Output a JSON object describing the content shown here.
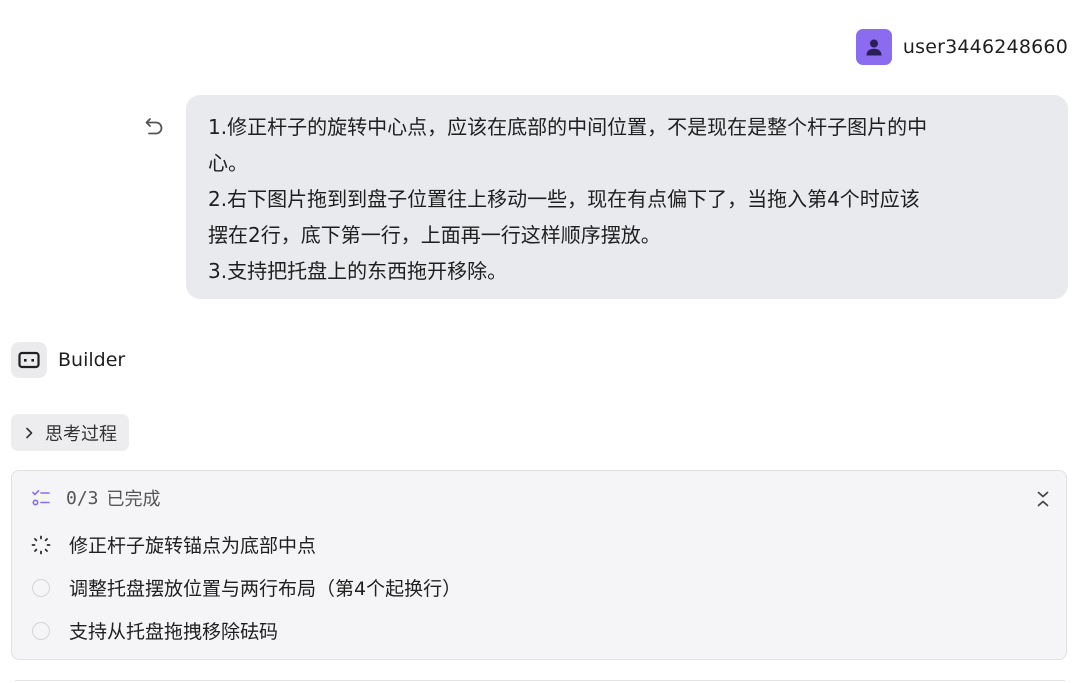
{
  "user": {
    "name": "user3446248660",
    "avatar_icon": "person-icon",
    "avatar_color": "#8b6cf0"
  },
  "message": {
    "lines": [
      "1.修正杆子的旋转中心点，应该在底部的中间位置，不是现在是整个杆子图片的中",
      "心。",
      "2.右下图片拖到到盘子位置往上移动一些，现在有点偏下了，当拖入第4个时应该",
      "摆在2行，底下第一行，上面再一行这样顺序摆放。",
      "3.支持把托盘上的东西拖开移除。"
    ],
    "undo_icon": "undo-icon",
    "bubble_color": "#e9eaee"
  },
  "builder": {
    "label": "Builder",
    "icon": "builder-terminal-icon"
  },
  "thinking": {
    "label": "思考过程",
    "icon": "chevron-right-icon"
  },
  "tasks": {
    "count": "0/3",
    "done_label": "已完成",
    "header_icon": "checklist-icon",
    "accent": "#8b6cf0",
    "collapse_icon": "collapse-icon",
    "items": [
      {
        "label": "修正杆子旋转锚点为底部中点",
        "status": "in-progress"
      },
      {
        "label": "调整托盘摆放位置与两行布局（第4个起换行）",
        "status": "pending"
      },
      {
        "label": "支持从托盘拖拽移除砝码",
        "status": "pending"
      }
    ]
  }
}
